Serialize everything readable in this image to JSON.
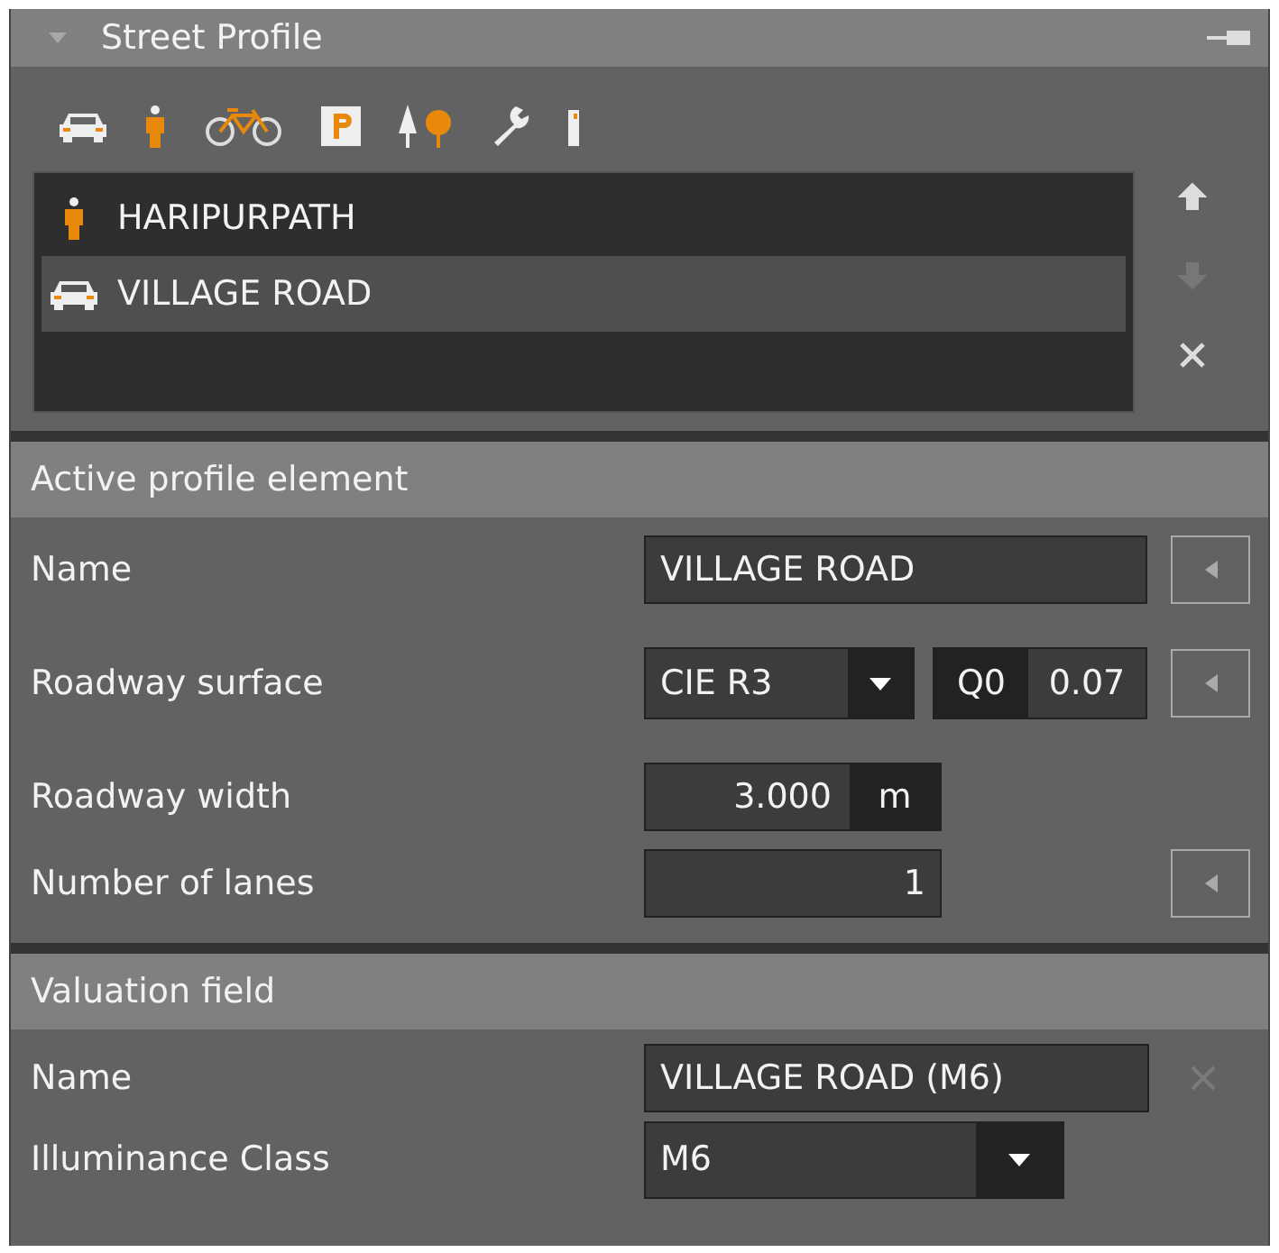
{
  "panel": {
    "title": "Street Profile",
    "expanded": true
  },
  "elements": [
    {
      "kind": "pedestrian",
      "label": "HARIPURPATH",
      "selected": false
    },
    {
      "kind": "car",
      "label": "VILLAGE ROAD",
      "selected": true
    }
  ],
  "list_buttons": [
    {
      "kind": "up",
      "disabled": false
    },
    {
      "kind": "down",
      "disabled": true
    },
    {
      "kind": "remove",
      "disabled": false
    }
  ],
  "active_element": {
    "title": "Active profile element",
    "rows": [
      {
        "kind": "text",
        "label": "Name",
        "value": "VILLAGE ROAD",
        "reset_button": true
      },
      {
        "kind": "surface",
        "label": "Roadway surface",
        "value": "CIE R3",
        "q_label": "Q0",
        "q_value": "0.07",
        "reset_button": true
      },
      {
        "kind": "unit",
        "label": "Roadway width",
        "value": "3.000",
        "unit": "m",
        "reset_button": false
      },
      {
        "kind": "number",
        "label": "Number of lanes",
        "value": "1",
        "reset_button": true
      }
    ]
  },
  "valuation_field": {
    "title": "Valuation field",
    "name_label": "Name",
    "name_value": "VILLAGE ROAD (M6)",
    "clear_disabled": true,
    "class_label": "Illuminance Class",
    "class_value": "M6"
  }
}
